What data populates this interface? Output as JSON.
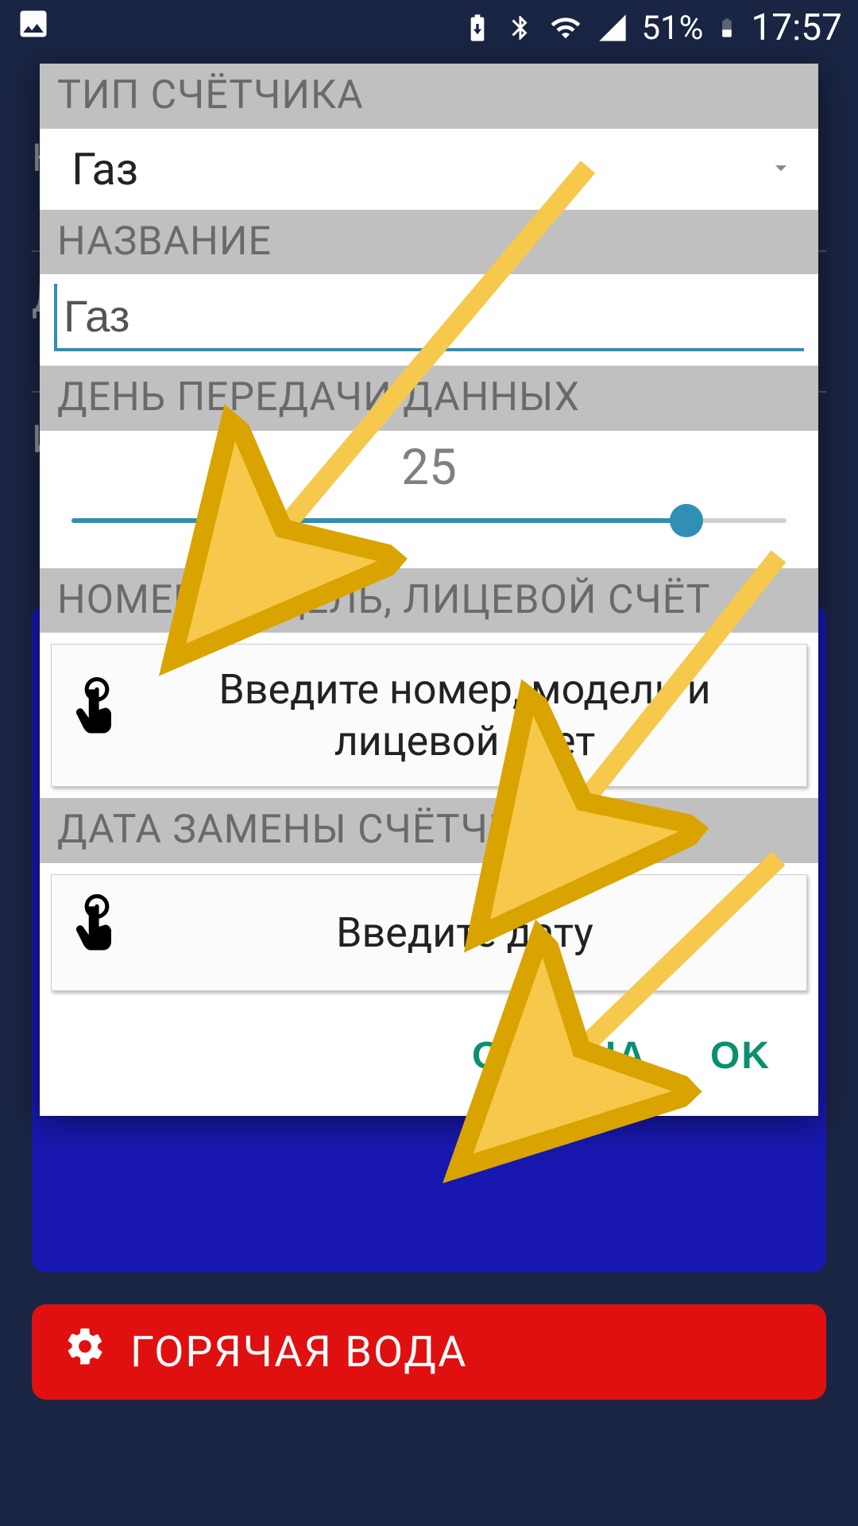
{
  "status": {
    "battery_pct": "51%",
    "time": "17:57"
  },
  "background": {
    "label_k": "К",
    "label_d": "Д",
    "label_i": "И",
    "red_card_title": "ГОРЯЧАЯ ВОДА"
  },
  "dialog": {
    "meter_type": {
      "header": "ТИП СЧЁТЧИКА",
      "value": "Газ"
    },
    "name": {
      "header": "НАЗВАНИЕ",
      "value": "Газ"
    },
    "day": {
      "header": "ДЕНЬ ПЕРЕДАЧИ ДАННЫХ",
      "value": "25",
      "percent": 86
    },
    "numbers": {
      "header": "НОМЕР, МОДЕЛЬ, ЛИЦЕВОЙ СЧЁТ",
      "placeholder": "Введите номер, модель и лицевой счет"
    },
    "replace_date": {
      "header": "ДАТА ЗАМЕНЫ СЧЁТЧИКА",
      "placeholder": "Введите дату"
    },
    "footer": {
      "cancel": "ОТМЕНА",
      "ok": "OK"
    }
  },
  "colors": {
    "accent": "#2f8fb5",
    "action": "#0a9070"
  }
}
